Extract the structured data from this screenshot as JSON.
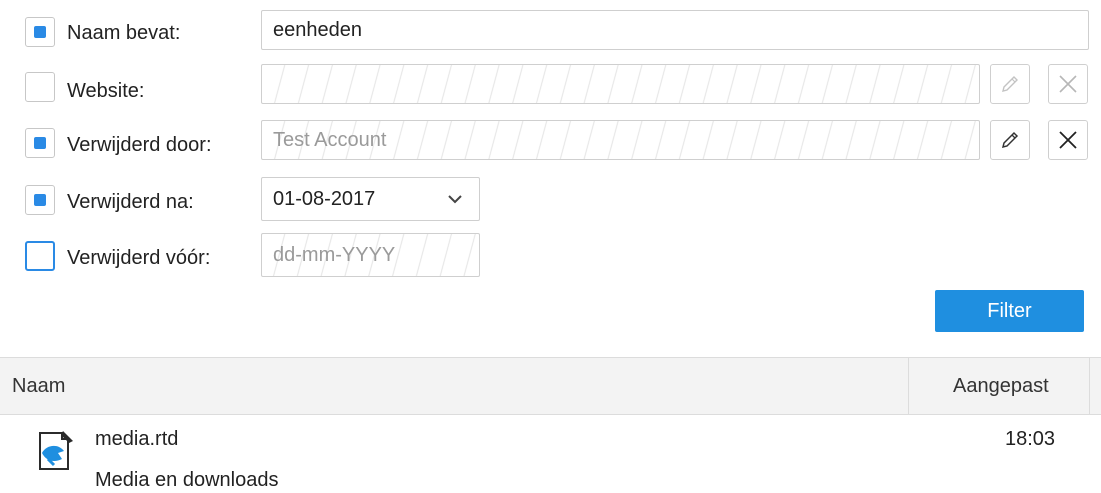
{
  "filters": [
    {
      "key": "name",
      "label": "Naam bevat:",
      "checked": true,
      "value": "eenheden",
      "placeholder": ""
    },
    {
      "key": "website",
      "label": "Website:",
      "checked": false,
      "value": "",
      "placeholder": ""
    },
    {
      "key": "removed_by",
      "label": "Verwijderd door:",
      "checked": true,
      "value": "",
      "placeholder": "Test Account"
    },
    {
      "key": "removed_after",
      "label": "Verwijderd na:",
      "checked": true,
      "value": "01-08-2017",
      "placeholder": ""
    },
    {
      "key": "removed_before",
      "label": "Verwijderd vóór:",
      "checked": false,
      "value": "",
      "placeholder": "dd-mm-YYYY"
    }
  ],
  "actions": {
    "website_edit_icon": "pencil-icon",
    "website_clear_icon": "close-icon",
    "removed_by_edit_icon": "pencil-icon",
    "removed_by_clear_icon": "close-icon",
    "dropdown_icon": "chevron-down-icon"
  },
  "filter_button": {
    "label": "Filter",
    "color": "#1f8fe0"
  },
  "grid": {
    "columns": {
      "name": "Naam",
      "modified": "Aangepast"
    },
    "rows": [
      {
        "name": "media.rtd",
        "description": "Media en downloads",
        "modified": "18:03",
        "icon": "site-icon"
      }
    ]
  },
  "colors": {
    "accent": "#2a8ae5"
  }
}
